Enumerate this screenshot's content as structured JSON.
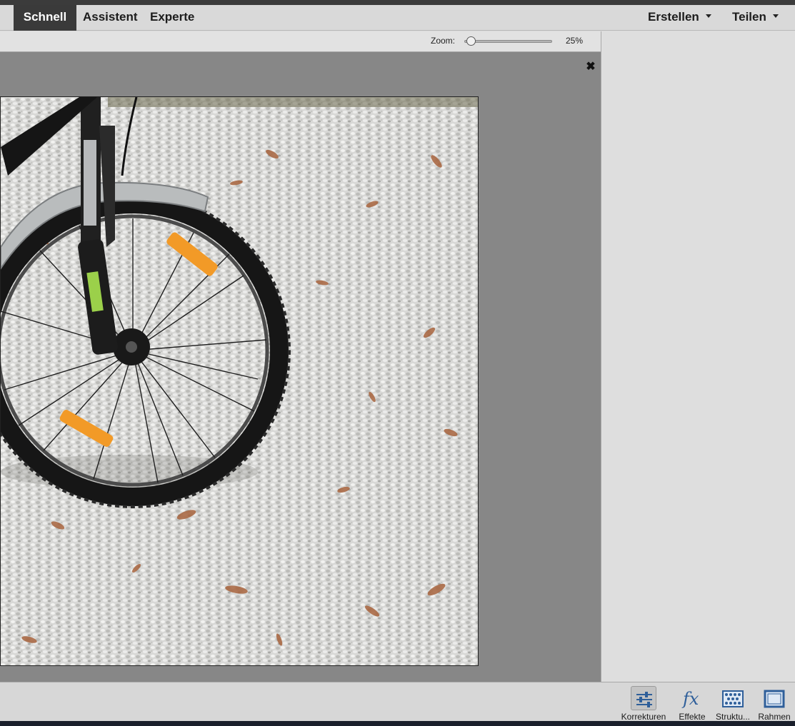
{
  "modes": {
    "quick": "Schnell",
    "guided": "Assistent",
    "expert": "Experte"
  },
  "menus": {
    "create": "Erstellen",
    "share": "Teilen"
  },
  "zoom": {
    "label": "Zoom:",
    "value": "25%",
    "level": 0.03
  },
  "document": {
    "close_symbol": "✖"
  },
  "tools": [
    {
      "label": "Korrekturen",
      "icon": "sliders-icon",
      "selected": true
    },
    {
      "label": "Effekte",
      "icon": "fx-icon",
      "selected": false
    },
    {
      "label": "Struktu...",
      "icon": "texture-icon",
      "selected": false
    },
    {
      "label": "Rahmen",
      "icon": "frame-icon",
      "selected": false
    }
  ],
  "colors": {
    "accent_blue": "#2f5f9a",
    "active_tab_bg": "#3a3a3a",
    "canvas_bg": "#878787"
  }
}
